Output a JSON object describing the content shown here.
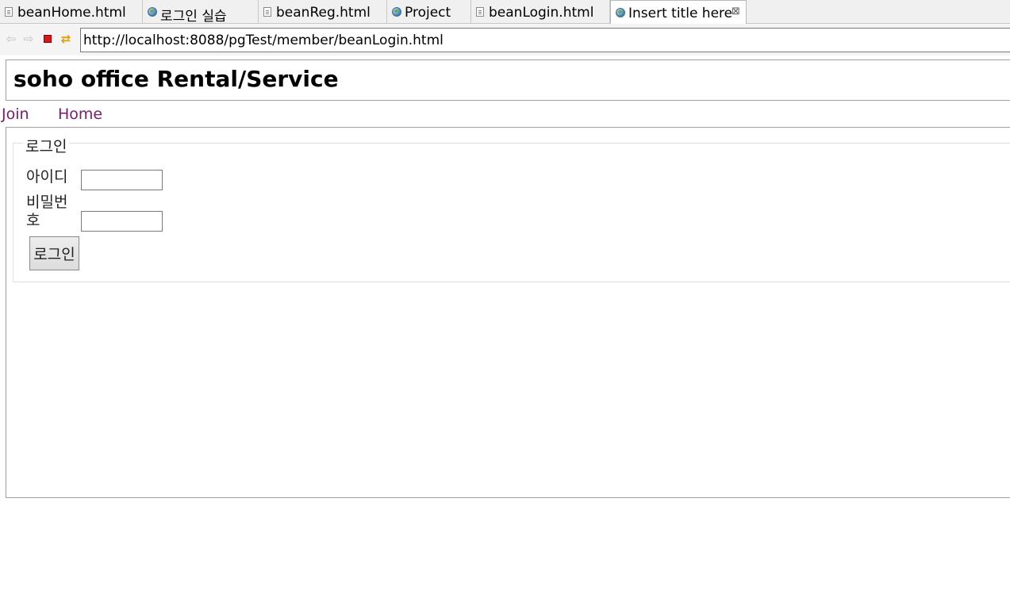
{
  "tabs": [
    {
      "label": "beanHome.html",
      "icon": "file-icon",
      "active": false
    },
    {
      "label": "로그인 실습",
      "icon": "globe-icon",
      "active": false
    },
    {
      "label": "beanReg.html",
      "icon": "file-icon",
      "active": false
    },
    {
      "label": "Project",
      "icon": "globe-icon",
      "active": false
    },
    {
      "label": "beanLogin.html",
      "icon": "file-icon",
      "active": false
    },
    {
      "label": "Insert title here",
      "icon": "globe-icon",
      "active": true,
      "close": "⊠"
    }
  ],
  "toolbar": {
    "back_icon": "⇦",
    "forward_icon": "⇨",
    "refresh_icon": "⇄",
    "url": "http://localhost:8088/pgTest/member/beanLogin.html"
  },
  "page": {
    "title": "soho office Rental/Service",
    "menu": {
      "join": "Join",
      "home": "Home"
    },
    "login": {
      "legend": "로그인",
      "id_label": "아이디",
      "id_value": "",
      "password_label": "비밀번호",
      "password_value": "",
      "submit_label": "로그인"
    }
  },
  "colors": {
    "link_visited": "#7b1a72",
    "frame_border": "#a0a0a0"
  }
}
